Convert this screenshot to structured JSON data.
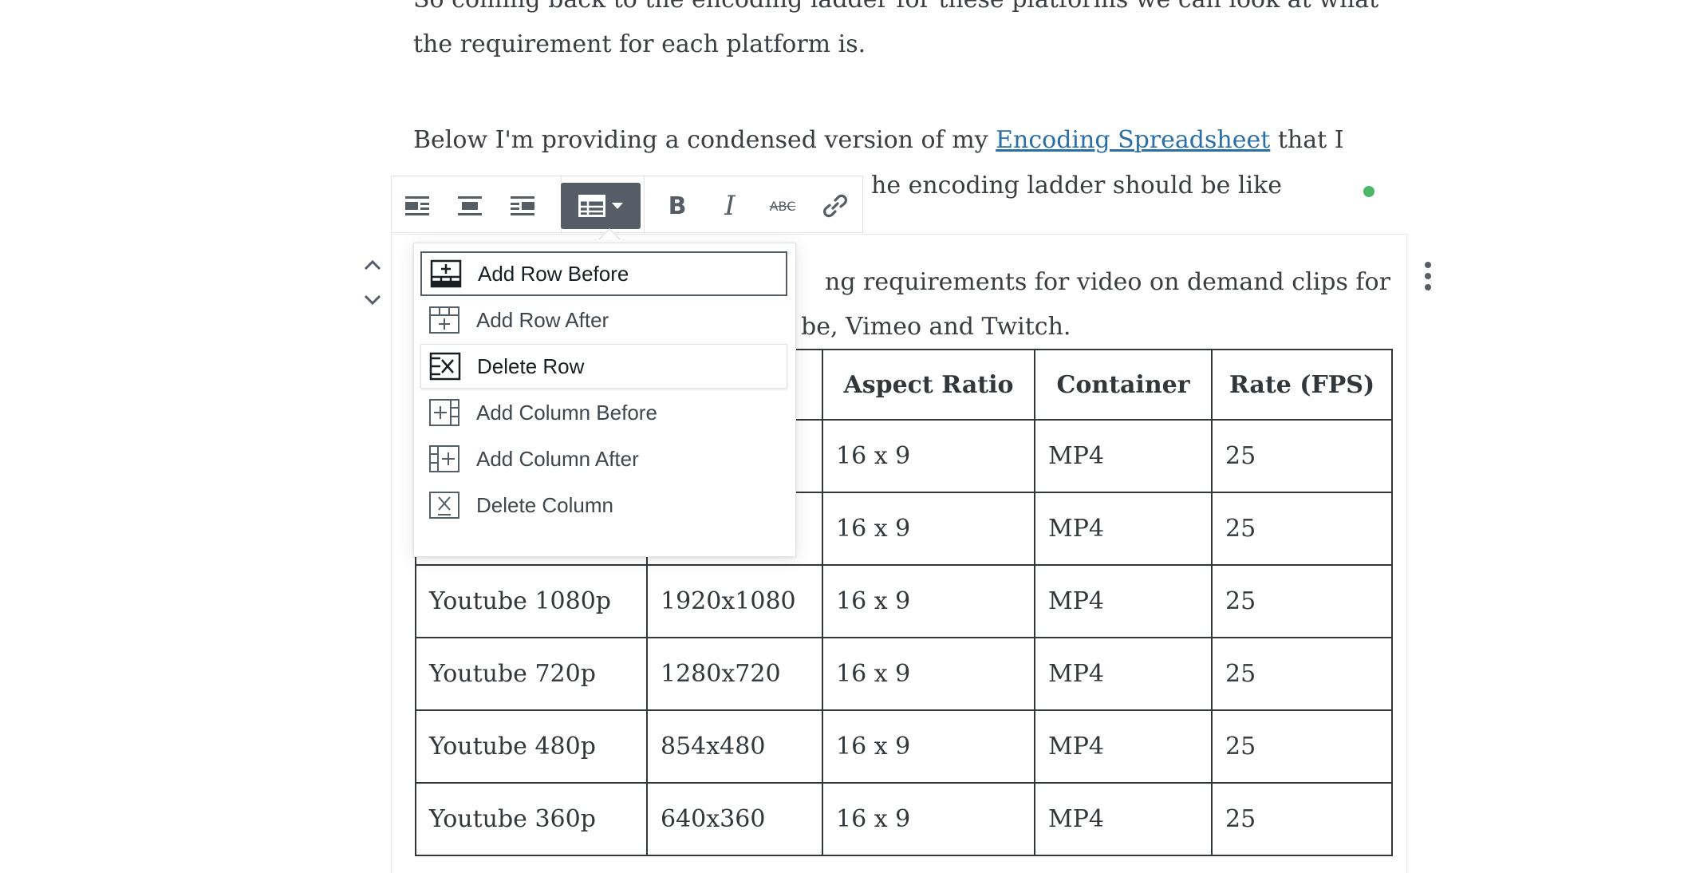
{
  "content": {
    "para1_line1": "So coming back to the encoding ladder for these platforms we can look at what",
    "para1_line2": "the requirement for each platform is.",
    "para2_before_link": "Below I'm providing a condensed version of my ",
    "para2_link": "Encoding Spreadsheet",
    "para2_after_link": " that I",
    "para2_line2_visible": "he encoding ladder should be like",
    "para3_line1_visible": "ng requirements for video on demand clips for",
    "para3_line2_visible": "be, Vimeo and Twitch."
  },
  "toolbar": {
    "buttons": [
      {
        "name": "align-left-icon"
      },
      {
        "name": "align-center-icon"
      },
      {
        "name": "align-right-icon"
      },
      {
        "name": "table-edit-icon"
      },
      {
        "name": "bold-icon",
        "label": "B"
      },
      {
        "name": "italic-icon",
        "label": "I"
      },
      {
        "name": "strikethrough-icon",
        "label": "ABC"
      },
      {
        "name": "link-icon"
      }
    ]
  },
  "table_menu": {
    "items": [
      {
        "label": "Add Row Before",
        "icon": "add-row-before-icon",
        "state": "focused"
      },
      {
        "label": "Add Row After",
        "icon": "add-row-after-icon",
        "state": ""
      },
      {
        "label": "Delete Row",
        "icon": "delete-row-icon",
        "state": "hovered"
      },
      {
        "label": "Add Column Before",
        "icon": "add-column-before-icon",
        "state": ""
      },
      {
        "label": "Add Column After",
        "icon": "add-column-after-icon",
        "state": ""
      },
      {
        "label": "Delete Column",
        "icon": "delete-column-icon",
        "state": ""
      }
    ]
  },
  "table": {
    "headers": [
      "",
      "",
      "Aspect Ratio",
      "Container",
      "Rate (FPS)"
    ],
    "rows": [
      [
        "",
        "",
        "16 x 9",
        "MP4",
        "25"
      ],
      [
        "",
        "",
        "16 x 9",
        "MP4",
        "25"
      ],
      [
        "Youtube 1080p",
        "1920x1080",
        "16 x 9",
        "MP4",
        "25"
      ],
      [
        "Youtube 720p",
        "1280x720",
        "16 x 9",
        "MP4",
        "25"
      ],
      [
        "Youtube 480p",
        "854x480",
        "16 x 9",
        "MP4",
        "25"
      ],
      [
        "Youtube 360p",
        "640x360",
        "16 x 9",
        "MP4",
        "25"
      ]
    ]
  },
  "colors": {
    "link": "#2a6fa8",
    "toolbar_active": "#555d66",
    "status_dot": "#4ab866"
  }
}
